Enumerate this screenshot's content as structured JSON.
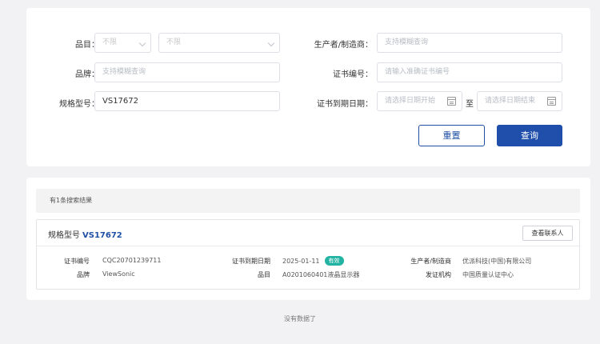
{
  "search": {
    "category_label": "品目：",
    "category_select1": "不限",
    "category_select2": "不限",
    "brand_label": "品牌：",
    "brand_placeholder": "支持模糊查询",
    "model_label": "规格型号：",
    "model_value": "VS17672",
    "maker_label": "生产者/制造商：",
    "maker_placeholder": "支持模糊查询",
    "cert_no_label": "证书编号：",
    "cert_no_placeholder": "请输入准确证书编号",
    "expiry_label": "证书到期日期：",
    "date_start_placeholder": "请选择日期开始",
    "date_sep": "至",
    "date_end_placeholder": "请选择日期结束",
    "reset_label": "重置",
    "query_label": "查询"
  },
  "results": {
    "summary": "有1条搜索结果",
    "items": [
      {
        "model_label": "规格型号",
        "model_value": "VS17672",
        "contact_label": "查看联系人",
        "cert_no_label": "证书编号",
        "cert_no": "CQC20701239711",
        "brand_label": "品牌",
        "brand": "ViewSonic",
        "expiry_label": "证书到期日期",
        "expiry": "2025-01-11",
        "status": "有效",
        "category_label": "品目",
        "category": "A0201060401液晶显示器",
        "maker_label": "生产者/制造商",
        "maker": "优派科技(中国)有限公司",
        "issuer_label": "发证机构",
        "issuer": "中国质量认证中心"
      }
    ]
  },
  "footer": {
    "no_more": "没有数据了"
  },
  "colors": {
    "primary": "#1f4fab",
    "status_valid": "#23b3a3"
  }
}
